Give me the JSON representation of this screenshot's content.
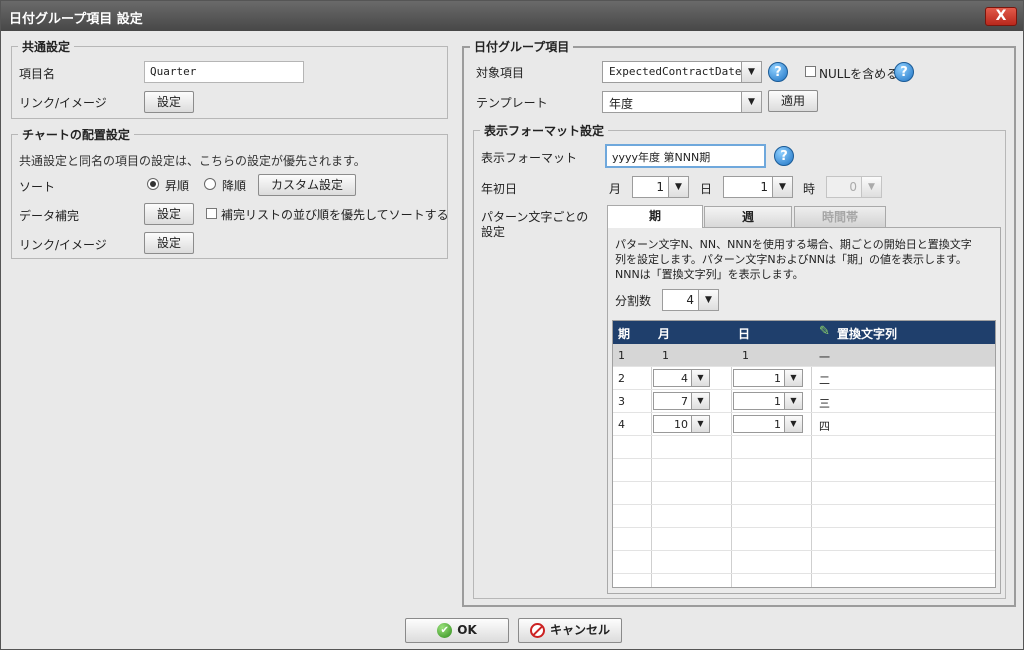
{
  "window": {
    "title": "日付グループ項目 設定",
    "close_label": "X"
  },
  "common": {
    "legend": "共通設定",
    "item_name_label": "項目名",
    "item_name_value": "Quarter",
    "link_label": "リンク/イメージ",
    "link_button": "設定"
  },
  "chart": {
    "legend": "チャートの配置設定",
    "note": "共通設定と同名の項目の設定は、こちらの設定が優先されます。",
    "sort_label": "ソート",
    "sort_asc": "昇順",
    "sort_desc": "降順",
    "sort_selected": "asc",
    "custom_button": "カスタム設定",
    "data_label": "データ補完",
    "data_button": "設定",
    "data_check_label": "補完リストの並び順を優先してソートする",
    "link_label": "リンク/イメージ",
    "link_button": "設定"
  },
  "dategroup": {
    "legend": "日付グループ項目",
    "target_label": "対象項目",
    "target_value": "ExpectedContractDate",
    "null_label": "NULLを含める",
    "template_label": "テンプレート",
    "template_value": "年度",
    "apply_button": "適用"
  },
  "format": {
    "legend": "表示フォーマット設定",
    "format_label": "表示フォーマット",
    "format_value": "yyyy年度 第NNN期",
    "start_label": "年初日",
    "month_label": "月",
    "month_value": "1",
    "day_label": "日",
    "day_value": "1",
    "hour_label": "時",
    "hour_value": "0",
    "pattern_label_1": "パターン文字ごとの",
    "pattern_label_2": "設定",
    "tabs": [
      "期",
      "週",
      "時間帯"
    ],
    "desc_1": "パターン文字N、NN、NNNを使用する場合、期ごとの開始日と置換文字",
    "desc_2": "列を設定します。パターン文字NおよびNNは「期」の値を表示します。",
    "desc_3": "NNNは「置換文字列」を表示します。",
    "split_label": "分割数",
    "split_value": "4"
  },
  "grid": {
    "headers": [
      "期",
      "月",
      "日",
      "置換文字列"
    ],
    "rows": [
      {
        "period": "1",
        "month": "1",
        "day": "1",
        "text": "一"
      },
      {
        "period": "2",
        "month": "4",
        "day": "1",
        "text": "二"
      },
      {
        "period": "3",
        "month": "7",
        "day": "1",
        "text": "三"
      },
      {
        "period": "4",
        "month": "10",
        "day": "1",
        "text": "四"
      }
    ]
  },
  "footer": {
    "ok": "OK",
    "cancel": "キャンセル"
  }
}
